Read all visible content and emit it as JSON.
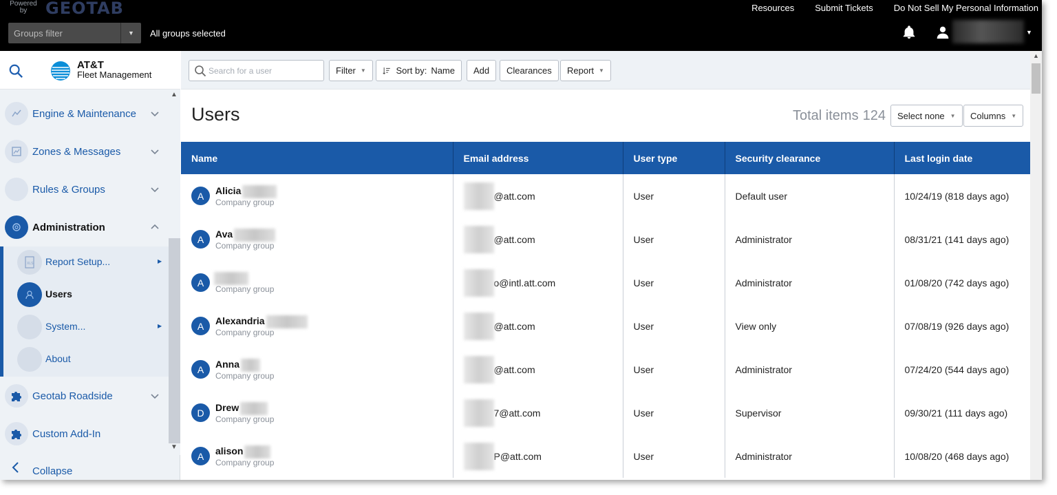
{
  "topbar": {
    "powered_by": "Powered by",
    "brand": "GEOTAB",
    "groups_filter_placeholder": "Groups filter",
    "groups_selected": "All groups selected",
    "links": [
      "Resources",
      "Submit Tickets",
      "Do Not Sell My Personal Information"
    ]
  },
  "sidebar": {
    "logo_line1": "AT&T",
    "logo_line2": "Fleet Management",
    "items": [
      {
        "label": "Engine & Maintenance",
        "icon": "engine-icon"
      },
      {
        "label": "Zones & Messages",
        "icon": "map-icon"
      },
      {
        "label": "Rules & Groups",
        "icon": "rules-icon"
      },
      {
        "label": "Administration",
        "icon": "gear-icon"
      },
      {
        "label": "Geotab Roadside",
        "icon": "puzzle-icon"
      },
      {
        "label": "Custom Add-In",
        "icon": "puzzle-icon"
      }
    ],
    "sub_items": [
      {
        "label": "Report Setup...",
        "icon": "xls-icon"
      },
      {
        "label": "Users",
        "icon": "user-icon"
      },
      {
        "label": "System...",
        "icon": "system-icon"
      },
      {
        "label": "About",
        "icon": "info-icon"
      }
    ],
    "collapse_label": "Collapse"
  },
  "toolbar": {
    "search_placeholder": "Search for a user",
    "filter_label": "Filter",
    "sort_prefix": "Sort by:",
    "sort_value": "Name",
    "add_label": "Add",
    "clearances_label": "Clearances",
    "report_label": "Report"
  },
  "header": {
    "title": "Users",
    "total_label": "Total items",
    "total_count": "124",
    "select_none_label": "Select none",
    "columns_label": "Columns"
  },
  "table": {
    "columns": [
      "Name",
      "Email address",
      "User type",
      "Security clearance",
      "Last login date"
    ],
    "rows": [
      {
        "initial": "A",
        "name": "Alicia",
        "group": "Company group",
        "email": "@att.com",
        "type": "User",
        "clearance": "Default user",
        "last_login": "10/24/19 (818 days ago)"
      },
      {
        "initial": "A",
        "name": "Ava",
        "group": "Company group",
        "email": "@att.com",
        "type": "User",
        "clearance": "Administrator",
        "last_login": "08/31/21 (141 days ago)"
      },
      {
        "initial": "A",
        "name": "",
        "group": "Company group",
        "email": "o@intl.att.com",
        "type": "User",
        "clearance": "Administrator",
        "last_login": "01/08/20 (742 days ago)"
      },
      {
        "initial": "A",
        "name": "Alexandria",
        "group": "Company group",
        "email": "@att.com",
        "type": "User",
        "clearance": "View only",
        "last_login": "07/08/19 (926 days ago)"
      },
      {
        "initial": "A",
        "name": "Anna",
        "group": "Company group",
        "email": "@att.com",
        "type": "User",
        "clearance": "Administrator",
        "last_login": "07/24/20 (544 days ago)"
      },
      {
        "initial": "D",
        "name": "Drew",
        "group": "Company group",
        "email": "7@att.com",
        "type": "User",
        "clearance": "Supervisor",
        "last_login": "09/30/21 (111 days ago)"
      },
      {
        "initial": "A",
        "name": "alison",
        "group": "Company group",
        "email": "P@att.com",
        "type": "User",
        "clearance": "Administrator",
        "last_login": "10/08/20 (468 days ago)"
      }
    ]
  },
  "colors": {
    "accent": "#1a5aa8",
    "topbar": "#000000",
    "sidebar_bg": "#eef2f6"
  }
}
